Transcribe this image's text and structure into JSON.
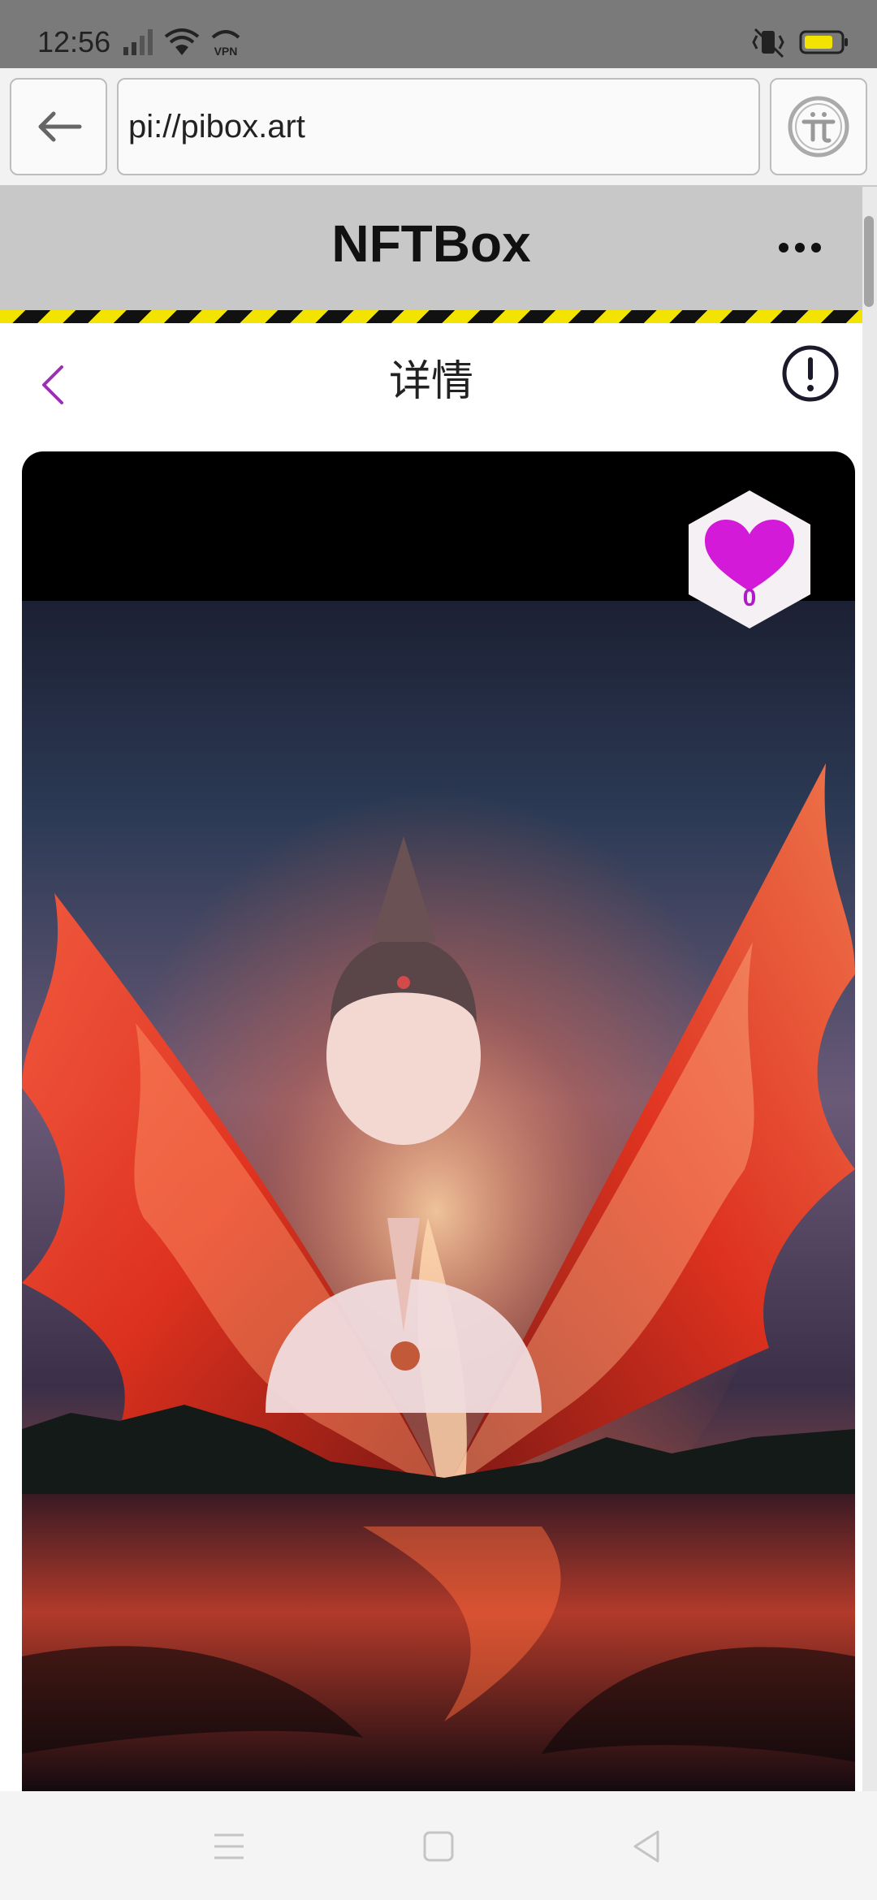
{
  "status_bar": {
    "time": "12:56",
    "icons": [
      "cellular-signal-icon",
      "wifi-icon",
      "vpn-icon",
      "vibrate-icon",
      "battery-icon"
    ],
    "vpn_label": "VPN"
  },
  "browser": {
    "url": "pi://pibox.art"
  },
  "app": {
    "title": "NFTBox"
  },
  "detail": {
    "title": "详情"
  },
  "nft": {
    "like_count": "0"
  },
  "colors": {
    "accent_purple": "#9b2fb5",
    "heart_magenta": "#d21ad8",
    "header_gray": "#c8c8c8",
    "hazard_yellow": "#f2e400"
  }
}
